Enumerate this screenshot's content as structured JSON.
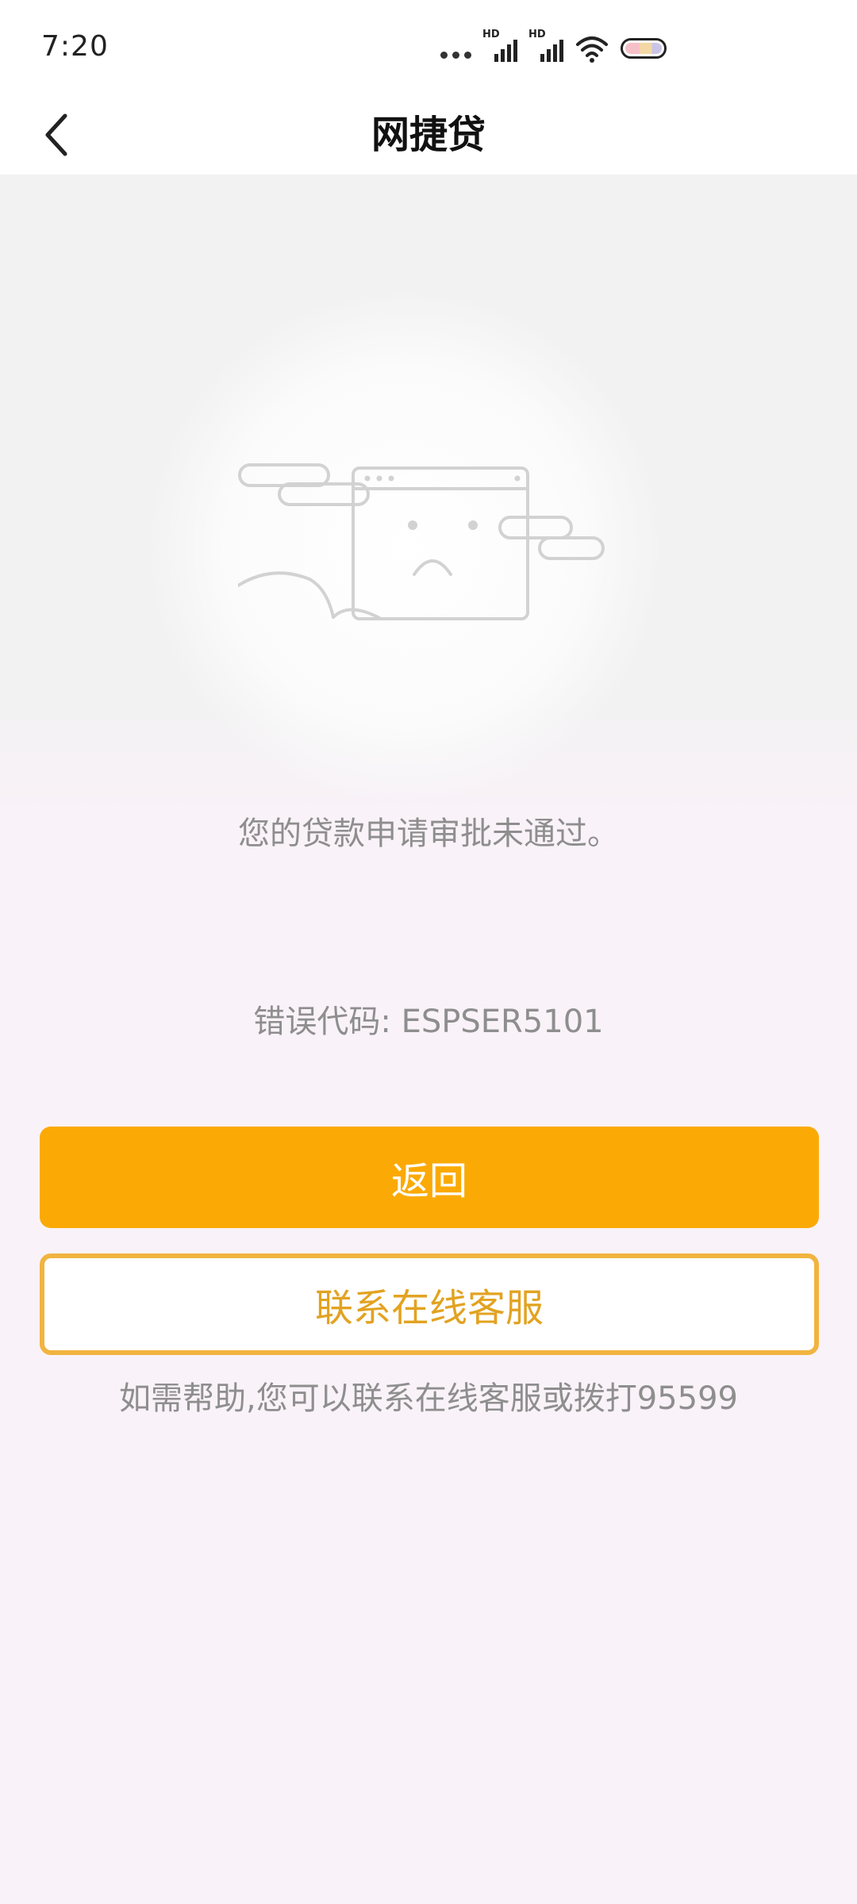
{
  "status_bar": {
    "time": "7:20",
    "signal_1_label": "HD",
    "signal_2_label": "HD",
    "icons": [
      "more-dots-icon",
      "signal-icon",
      "signal-icon",
      "wifi-icon",
      "battery-icon"
    ]
  },
  "nav": {
    "title": "网捷贷",
    "back_icon": "chevron-left-icon"
  },
  "result": {
    "illustration": "sad-window-icon",
    "message": "您的贷款申请审批未通过。",
    "error_code": "错误代码: ESPSER5101"
  },
  "actions": {
    "back_label": "返回",
    "contact_label": "联系在线客服"
  },
  "help_text": "如需帮助,您可以联系在线客服或拨打95599",
  "colors": {
    "primary": "#fbaa05",
    "outline": "#f1b440",
    "outline_text": "#e2a321",
    "muted_text": "#8e8e8e",
    "page_bg": "#f9f2f8"
  }
}
